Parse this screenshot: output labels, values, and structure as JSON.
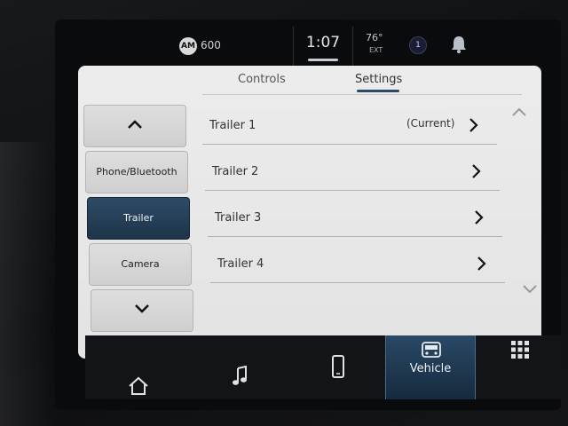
{
  "status_bar": {
    "radio_band": "AM",
    "radio_freq": "600",
    "time": "1:07",
    "temperature": "76°",
    "temp_label": "EXT",
    "alert_badge": "1"
  },
  "tabs": [
    {
      "label": "Controls",
      "active": false
    },
    {
      "label": "Settings",
      "active": true
    }
  ],
  "sidebar": {
    "items": [
      {
        "label": "Phone/Bluetooth",
        "active": false
      },
      {
        "label": "Trailer",
        "active": true
      },
      {
        "label": "Camera",
        "active": false
      }
    ]
  },
  "trailers": [
    {
      "label": "Trailer 1",
      "status": "(Current)"
    },
    {
      "label": "Trailer 2",
      "status": ""
    },
    {
      "label": "Trailer 3",
      "status": ""
    },
    {
      "label": "Trailer 4",
      "status": ""
    }
  ],
  "bottom_nav": {
    "active_label": "Vehicle",
    "items": [
      "home-icon",
      "music-icon",
      "phone-icon",
      "vehicle-icon",
      "apps-grid-icon"
    ]
  },
  "colors": {
    "accent": "#2e4c66",
    "panel_bg": "#e8e8e8",
    "bezel": "#0d0e10"
  }
}
